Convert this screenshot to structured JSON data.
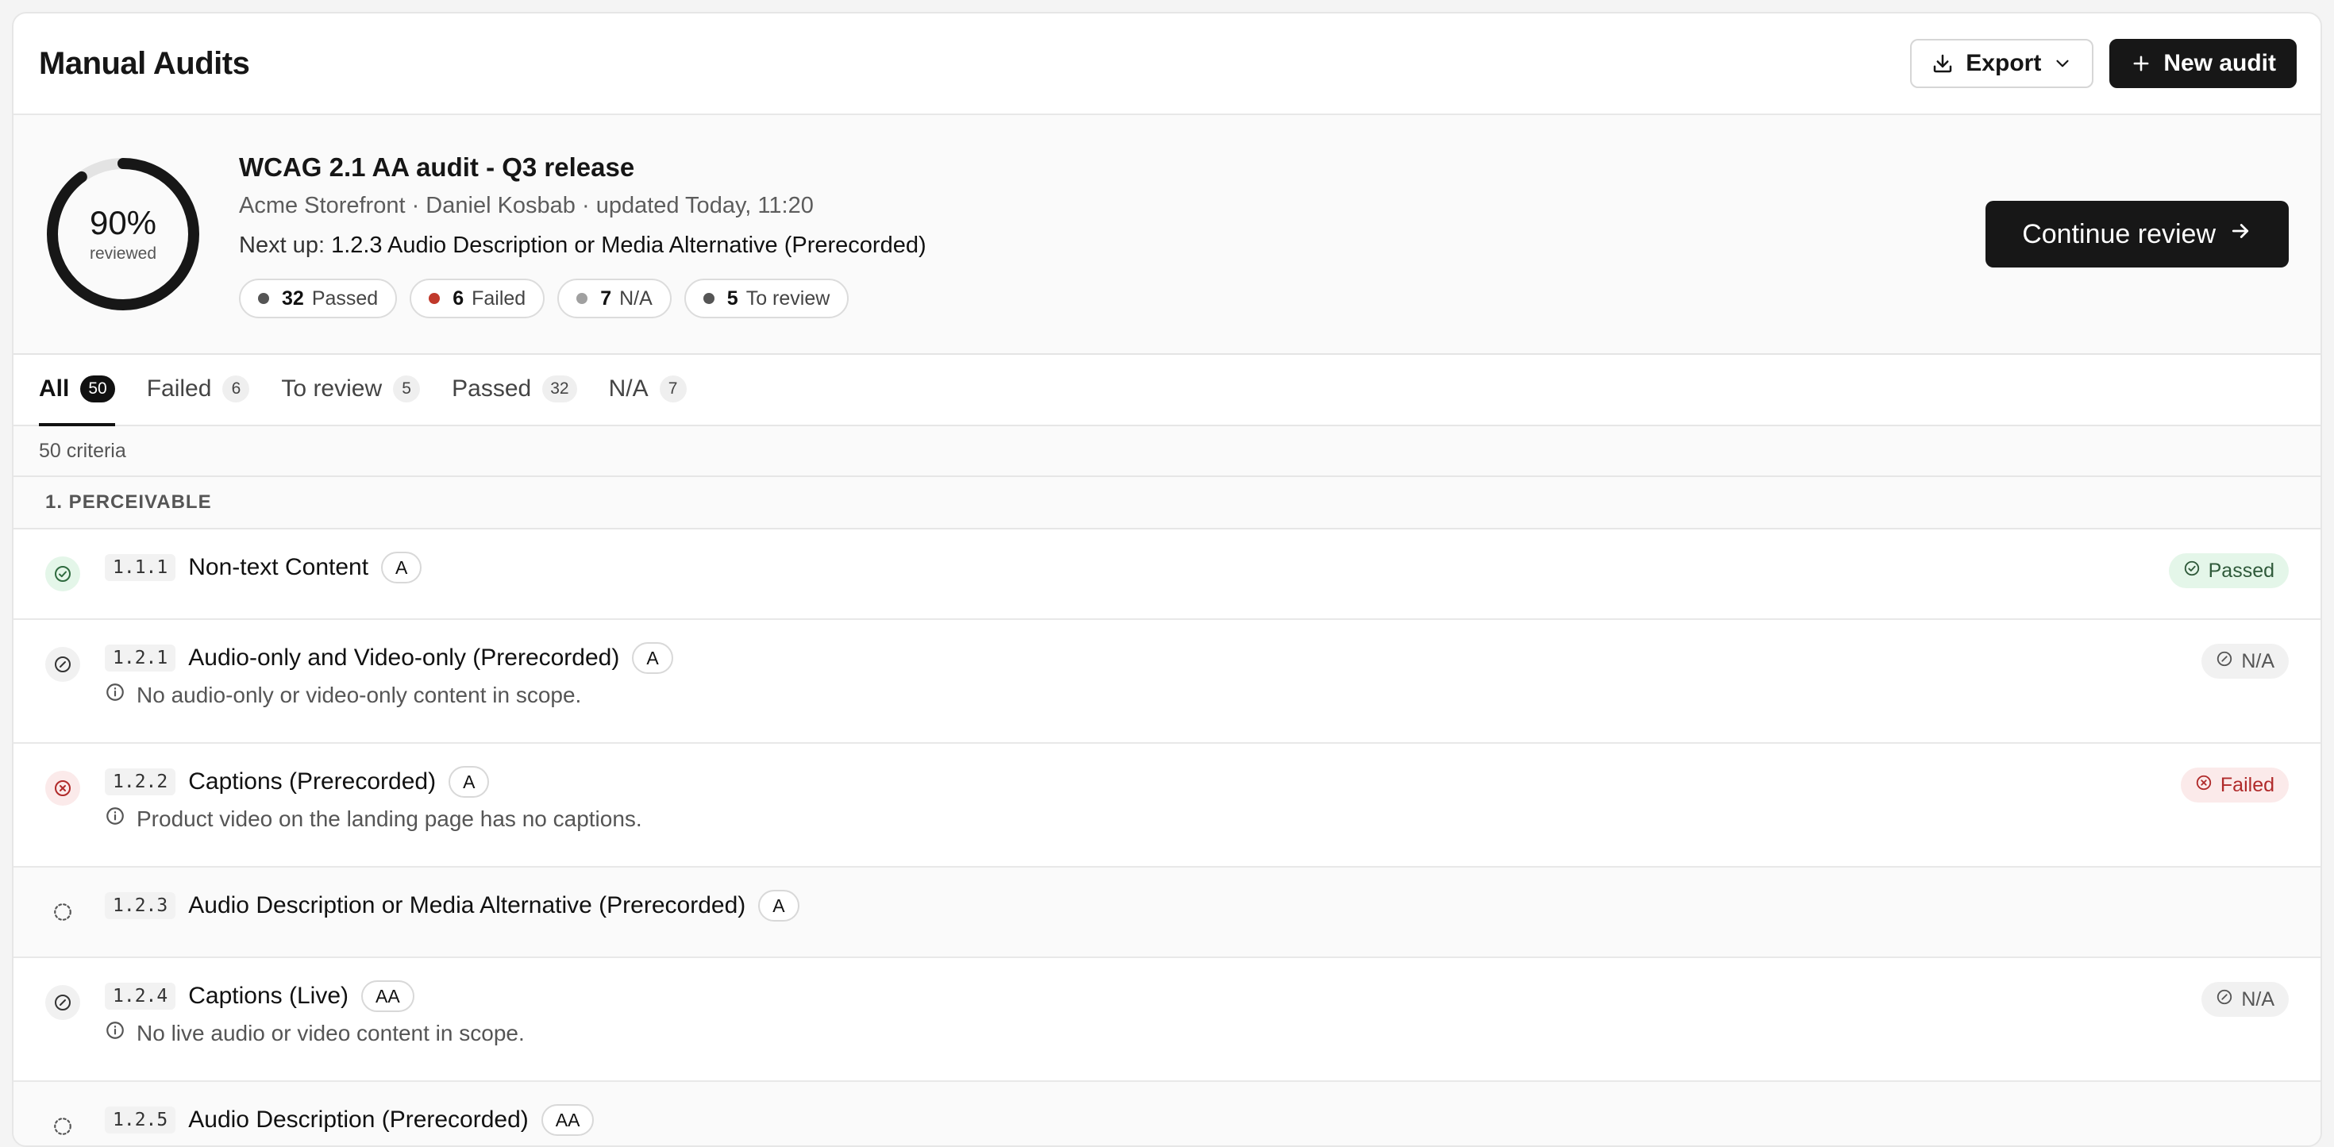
{
  "header": {
    "title": "Manual Audits",
    "export_label": "Export",
    "new_audit_label": "New audit"
  },
  "summary": {
    "progress_percent": 90,
    "progress_text": "90%",
    "progress_caption": "reviewed",
    "title": "WCAG 2.1 AA audit - Q3 release",
    "meta": "Acme Storefront · Daniel Kosbab · updated Today, 11:20",
    "next_prefix": "Next up: ",
    "next_item": "1.2.3 Audio Description or Media Alternative (Prerecorded)",
    "continue_label": "Continue review",
    "pills": [
      {
        "count": "32",
        "label": "Passed",
        "color": "#555555"
      },
      {
        "count": "6",
        "label": "Failed",
        "color": "#c0392b"
      },
      {
        "count": "7",
        "label": "N/A",
        "color": "#a0a0a0"
      },
      {
        "count": "5",
        "label": "To review",
        "color": "#555555"
      }
    ]
  },
  "tabs": [
    {
      "label": "All",
      "count": "50"
    },
    {
      "label": "Failed",
      "count": "6"
    },
    {
      "label": "To review",
      "count": "5"
    },
    {
      "label": "Passed",
      "count": "32"
    },
    {
      "label": "N/A",
      "count": "7"
    }
  ],
  "criteria_count": "50 criteria",
  "group": {
    "title": "1. PERCEIVABLE"
  },
  "rows": [
    {
      "code": "1.1.1",
      "name": "Non-text Content",
      "level": "A",
      "note": "",
      "status": "passed",
      "badge": "Passed"
    },
    {
      "code": "1.2.1",
      "name": "Audio-only and Video-only (Prerecorded)",
      "level": "A",
      "note": "No audio-only or video-only content in scope.",
      "status": "na",
      "badge": "N/A"
    },
    {
      "code": "1.2.2",
      "name": "Captions (Prerecorded)",
      "level": "A",
      "note": "Product video on the landing page has no captions.",
      "status": "failed",
      "badge": "Failed"
    },
    {
      "code": "1.2.3",
      "name": "Audio Description or Media Alternative (Prerecorded)",
      "level": "A",
      "note": "",
      "status": "review",
      "badge": ""
    },
    {
      "code": "1.2.4",
      "name": "Captions (Live)",
      "level": "AA",
      "note": "No live audio or video content in scope.",
      "status": "na",
      "badge": "N/A"
    },
    {
      "code": "1.2.5",
      "name": "Audio Description (Prerecorded)",
      "level": "AA",
      "note": "",
      "status": "review",
      "badge": ""
    }
  ]
}
